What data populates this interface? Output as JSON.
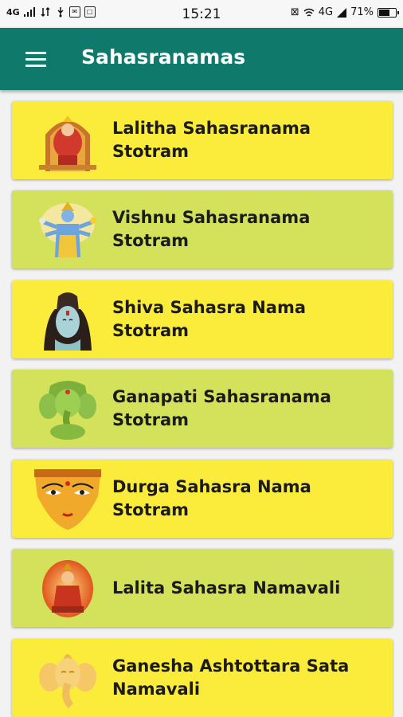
{
  "status_bar": {
    "network": "4G",
    "time": "15:21",
    "lte": "4G",
    "battery_percent": "71%",
    "battery_level": 0.71
  },
  "app_bar": {
    "title": "Sahasranamas",
    "menu_icon": "hamburger-menu-icon"
  },
  "items": [
    {
      "label": "Lalitha Sahasranama Stotram",
      "icon": "goddess-lalitha-icon",
      "bg": "#fbeb3b"
    },
    {
      "label": "Vishnu Sahasranama Stotram",
      "icon": "lord-vishnu-icon",
      "bg": "#d4e15a"
    },
    {
      "label": "Shiva Sahasra Nama Stotram",
      "icon": "lord-shiva-icon",
      "bg": "#fbeb3b"
    },
    {
      "label": "Ganapati Sahasranama Stotram",
      "icon": "lord-ganapati-icon",
      "bg": "#d4e15a"
    },
    {
      "label": "Durga Sahasra Nama Stotram",
      "icon": "goddess-durga-icon",
      "bg": "#fbeb3b"
    },
    {
      "label": "Lalita Sahasra Namavali",
      "icon": "goddess-lalita-icon",
      "bg": "#d4e15a"
    },
    {
      "label": "Ganesha Ashtottara Sata Namavali",
      "icon": "lord-ganesha-icon",
      "bg": "#fbeb3b"
    }
  ],
  "colors": {
    "app_bar": "#0f7a6c",
    "card_yellow": "#fbeb3b",
    "card_green": "#d4e15a"
  }
}
